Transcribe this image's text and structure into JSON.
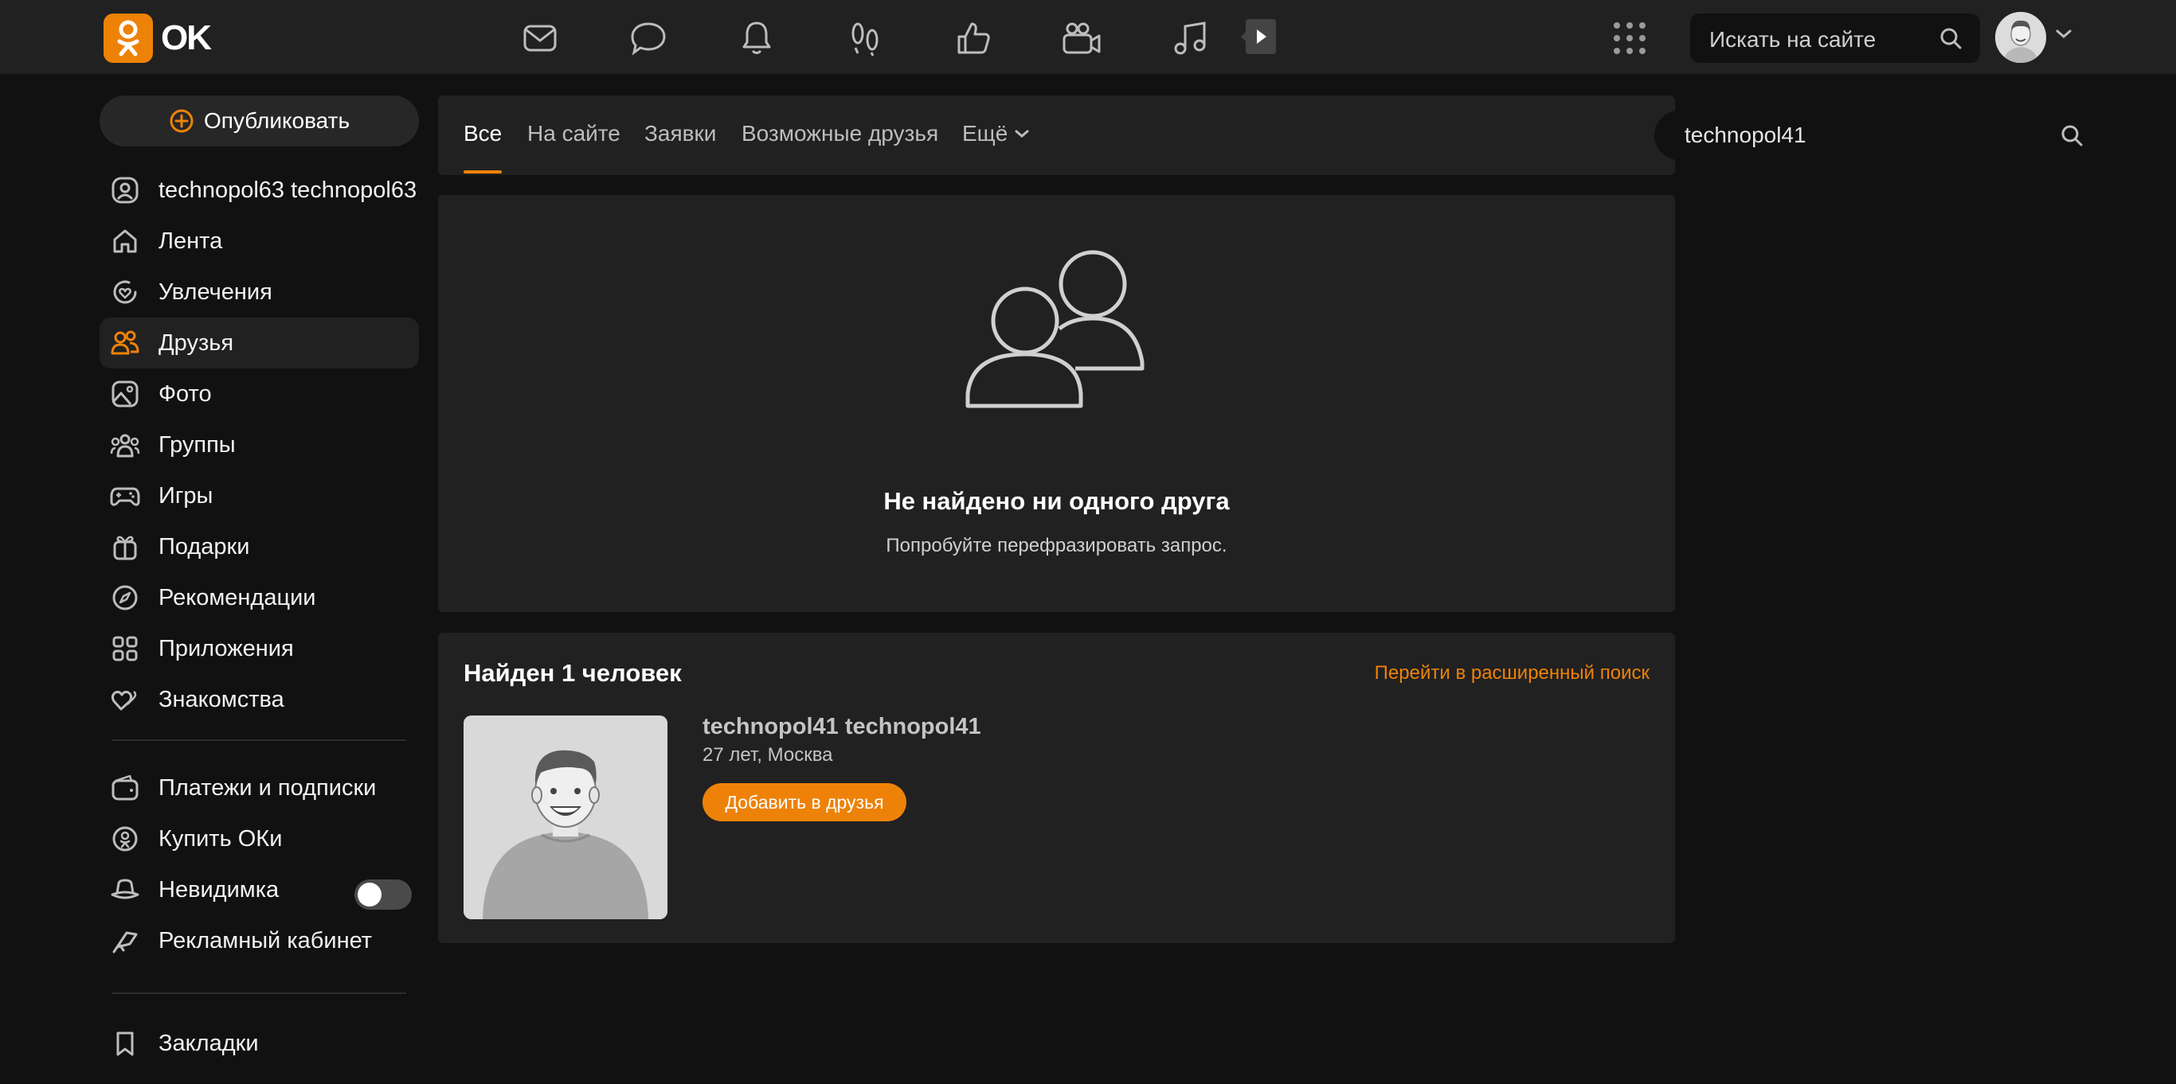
{
  "header": {
    "logo_text": "OK",
    "nav_icons": [
      "mail-icon",
      "chat-icon",
      "bell-icon",
      "footprints-icon",
      "like-icon",
      "video-camera-icon",
      "music-icon",
      "video-play-icon"
    ],
    "apps_icon": "apps-grid-icon",
    "search": {
      "placeholder": "Искать на сайте"
    }
  },
  "sidebar": {
    "publish_label": "Опубликовать",
    "items": [
      {
        "label": "technopol63 technopol63",
        "icon": "profile-icon"
      },
      {
        "label": "Лента",
        "icon": "home-icon"
      },
      {
        "label": "Увлечения",
        "icon": "heart-circle-icon"
      },
      {
        "label": "Друзья",
        "icon": "friends-icon",
        "active": true
      },
      {
        "label": "Фото",
        "icon": "photo-icon"
      },
      {
        "label": "Группы",
        "icon": "groups-icon"
      },
      {
        "label": "Игры",
        "icon": "gamepad-icon"
      },
      {
        "label": "Подарки",
        "icon": "gift-icon"
      },
      {
        "label": "Рекомендации",
        "icon": "compass-icon"
      },
      {
        "label": "Приложения",
        "icon": "apps-icon"
      },
      {
        "label": "Знакомства",
        "icon": "dating-icon"
      }
    ],
    "items2": [
      {
        "label": "Платежи и подписки",
        "icon": "wallet-icon"
      },
      {
        "label": "Купить ОКи",
        "icon": "coin-icon"
      },
      {
        "label": "Невидимка",
        "icon": "invisible-hat-icon",
        "toggle": false
      },
      {
        "label": "Рекламный кабинет",
        "icon": "megaphone-icon"
      }
    ],
    "items3": [
      {
        "label": "Закладки",
        "icon": "bookmark-icon"
      }
    ]
  },
  "tabs": {
    "items": [
      "Все",
      "На сайте",
      "Заявки",
      "Возможные друзья",
      "Ещё"
    ],
    "active_index": 0,
    "search_value": "technopol41"
  },
  "empty_state": {
    "title": "Не найдено ни одного друга",
    "subtitle": "Попробуйте перефразировать запрос."
  },
  "found": {
    "title": "Найден 1 человек",
    "advanced_link": "Перейти в расширенный поиск",
    "person": {
      "name": "technopol41 technopol41",
      "meta": "27 лет, Москва",
      "add_button": "Добавить в друзья"
    }
  },
  "colors": {
    "accent": "#ee8208",
    "background": "#111111",
    "panel": "#212121"
  }
}
